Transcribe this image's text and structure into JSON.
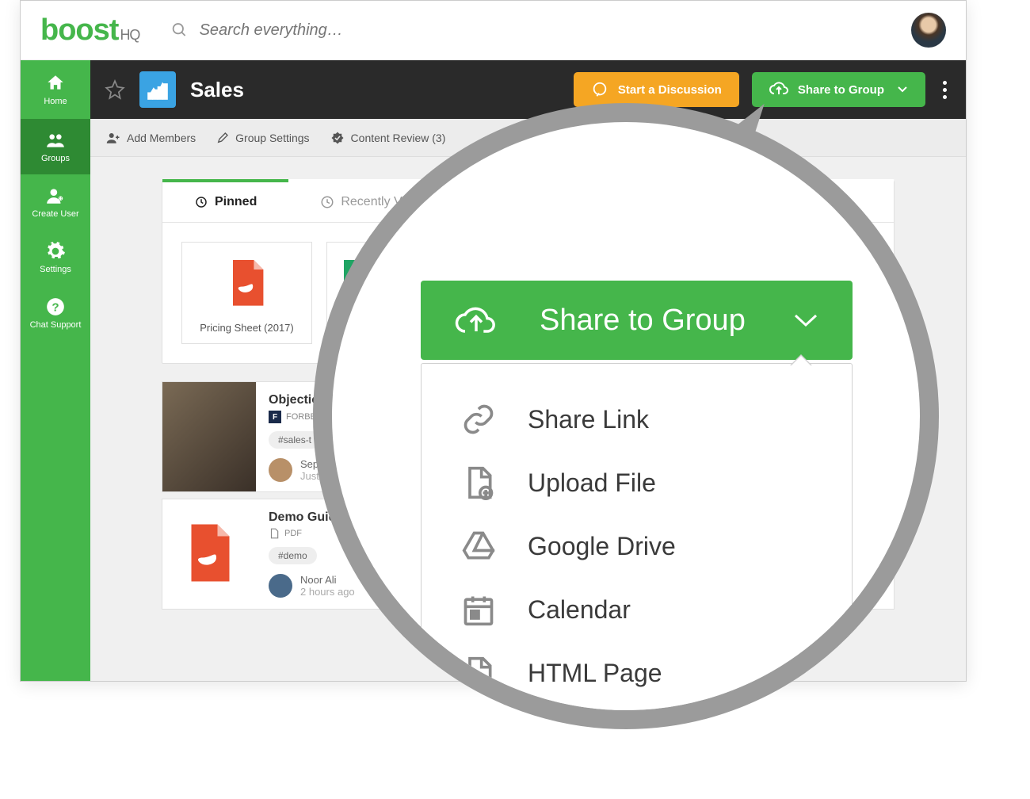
{
  "brand": {
    "name": "boost",
    "suffix": "HQ"
  },
  "search": {
    "placeholder": "Search everything…"
  },
  "sidebar": {
    "items": [
      {
        "label": "Home"
      },
      {
        "label": "Groups"
      },
      {
        "label": "Create User"
      },
      {
        "label": "Settings"
      },
      {
        "label": "Chat Support"
      }
    ]
  },
  "page": {
    "title": "Sales",
    "discussion_btn": "Start a Discussion",
    "share_btn": "Share to Group"
  },
  "toolbar": {
    "add_members": "Add Members",
    "group_settings": "Group Settings",
    "content_review": "Content Review (3)"
  },
  "tabs": {
    "pinned": "Pinned",
    "recent": "Recently Viewed"
  },
  "pinned_docs": [
    {
      "title": "Pricing Sheet (2017)",
      "type": "pdf"
    },
    {
      "title": "",
      "type": "sheets"
    },
    {
      "title": "",
      "type": "video"
    }
  ],
  "feed": [
    {
      "title": "Objection",
      "source": "FORBES",
      "tag": "#sales-t",
      "author": "Sep",
      "time": "Just"
    },
    {
      "title": "Demo Guide",
      "source": "PDF",
      "tag": "#demo",
      "author": "Noor Ali",
      "time": "2 hours ago"
    }
  ],
  "zoom": {
    "button": "Share to Group",
    "menu": [
      "Share Link",
      "Upload File",
      "Google Drive",
      "Calendar",
      "HTML Page"
    ]
  }
}
